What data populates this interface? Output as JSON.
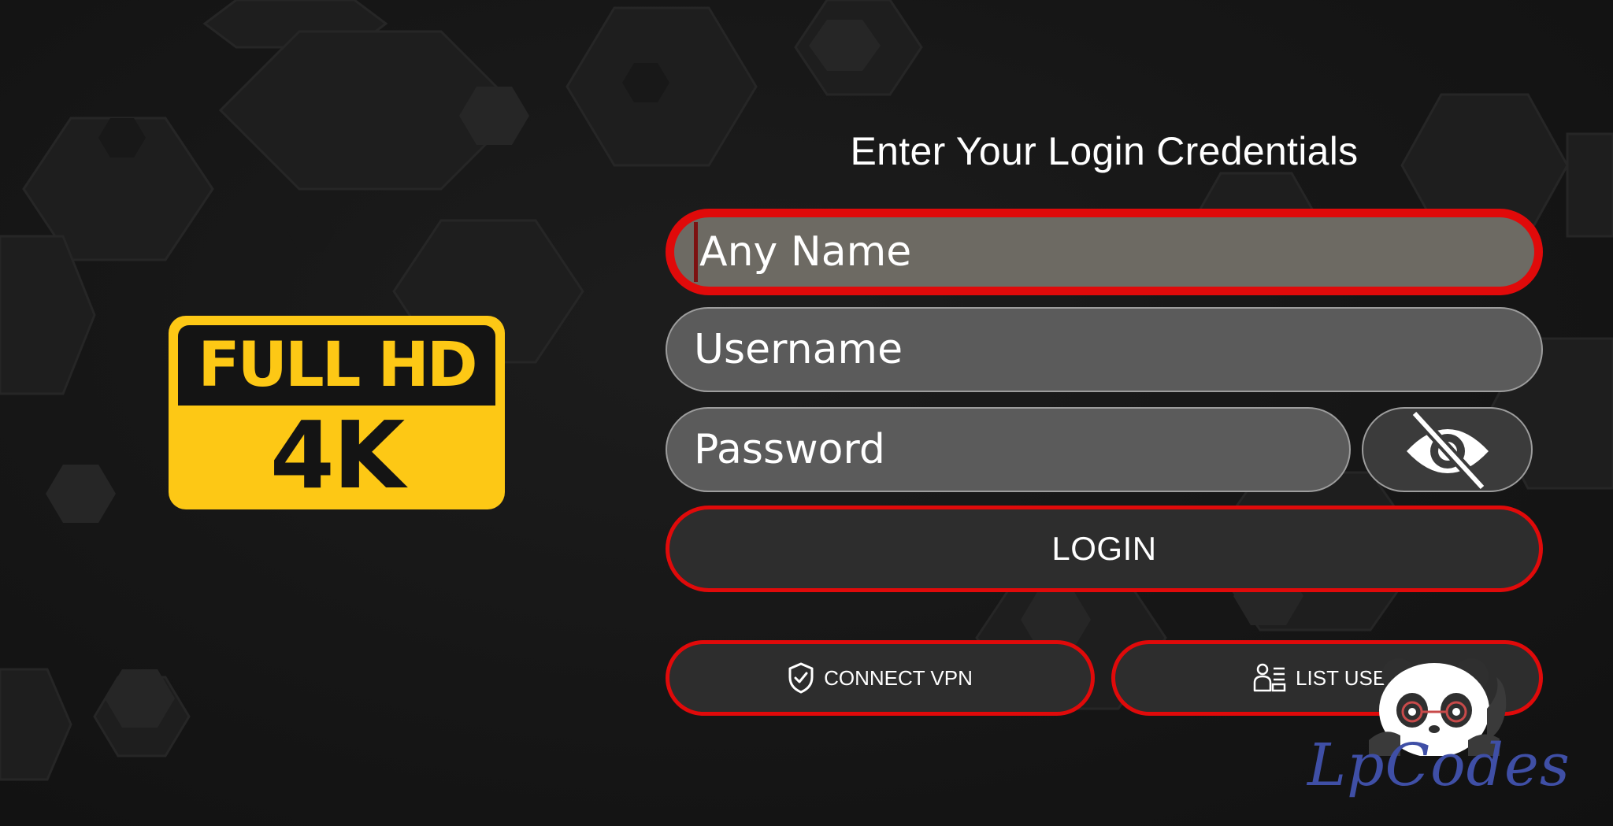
{
  "logo": {
    "top_text": "FULL HD",
    "bottom_text": "4K"
  },
  "form": {
    "title": "Enter Your Login Credentials",
    "name_placeholder": "Any Name",
    "username_placeholder": "Username",
    "password_placeholder": "Password",
    "password_toggle_icon": "eye-off-icon",
    "login_label": "LOGIN"
  },
  "actions": {
    "vpn_label": "CONNECT VPN",
    "vpn_icon": "shield-check-icon",
    "users_label": "LIST USER",
    "users_icon": "user-list-icon"
  },
  "watermark": {
    "text": "LpCodes"
  },
  "colors": {
    "accent": "#e00a0a",
    "logo_yellow": "#fdc815",
    "background": "#141414",
    "watermark": "#3f4fa6"
  }
}
